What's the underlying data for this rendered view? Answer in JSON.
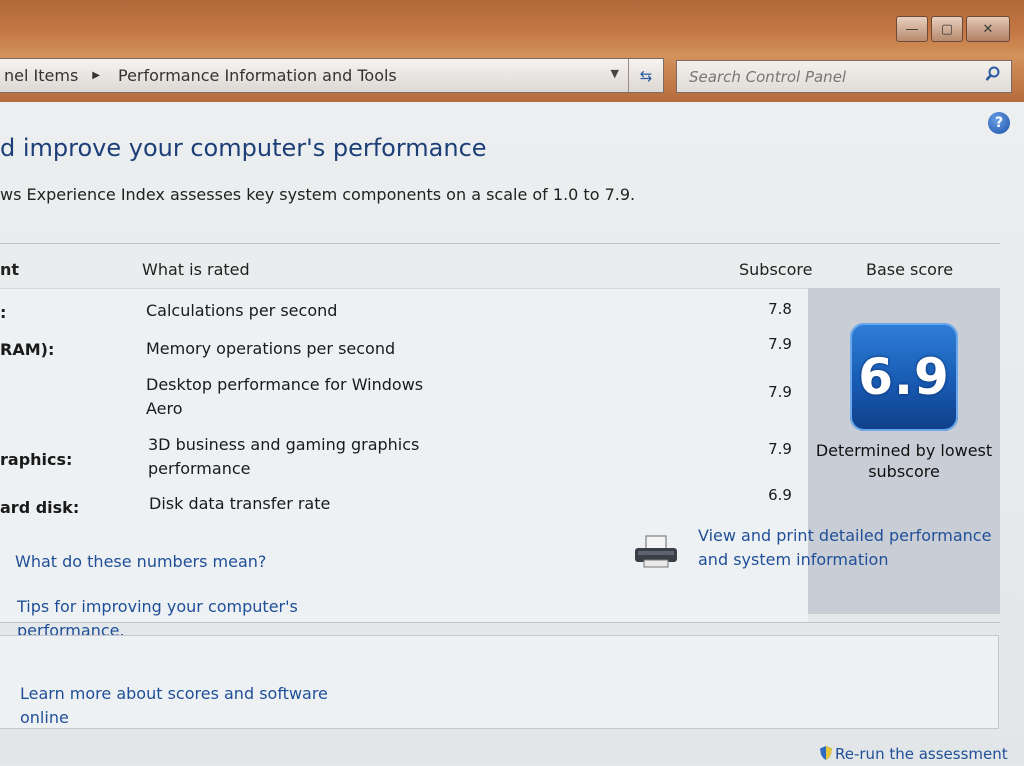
{
  "window": {
    "controls": {
      "minimize": "—",
      "maximize": "▢",
      "close": "✕"
    }
  },
  "addressbar": {
    "crumbs": [
      "nel Items",
      "Performance Information and Tools"
    ],
    "separator": "▶",
    "dropdown": "▼",
    "refresh": "⇆"
  },
  "search": {
    "placeholder": "Search Control Panel",
    "icon": "search-icon"
  },
  "help": {
    "label": "?"
  },
  "page": {
    "title": "d improve your computer's performance",
    "subtitle": "ws Experience Index assesses key system components on a scale of 1.0 to 7.9."
  },
  "table": {
    "headers": {
      "component": "nt",
      "what": "What is rated",
      "subscore": "Subscore",
      "base": "Base score"
    },
    "rows": [
      {
        "component": ":",
        "what": "Calculations per second",
        "subscore": "7.8"
      },
      {
        "component": "RAM):",
        "what": "Memory operations per second",
        "subscore": "7.9"
      },
      {
        "component": "",
        "what": "Desktop performance for Windows Aero",
        "subscore": "7.9"
      },
      {
        "component": "raphics:",
        "what": "3D business and gaming graphics performance",
        "subscore": "7.9"
      },
      {
        "component": "ard disk:",
        "what": "Disk data transfer rate",
        "subscore": "6.9"
      }
    ],
    "base_score": "6.9",
    "base_caption": "Determined by lowest subscore"
  },
  "links": {
    "numbers_mean": "What do these numbers mean?",
    "tips": "Tips for improving your computer's performance.",
    "view_print": "View and print detailed performance and system information",
    "learn_more": "Learn more about scores and software online",
    "rerun": "Re-run the assessment"
  },
  "colors": {
    "link": "#1f4f97",
    "title": "#1d3f78",
    "badge": "#185bb3"
  }
}
